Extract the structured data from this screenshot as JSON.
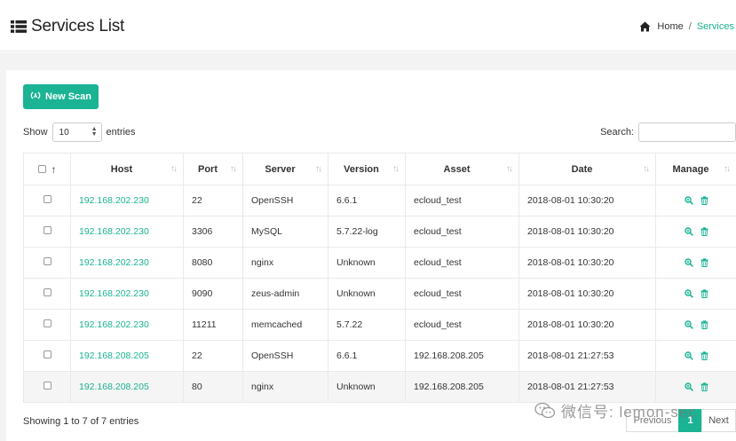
{
  "header": {
    "title": "Services List",
    "breadcrumb": {
      "home": "Home",
      "separator": "/",
      "current": "Services"
    }
  },
  "toolbar": {
    "new_scan_label": "New Scan"
  },
  "length": {
    "prefix": "Show",
    "value": "10",
    "suffix": "entries"
  },
  "search": {
    "label": "Search:",
    "value": ""
  },
  "table": {
    "columns": [
      "Host",
      "Port",
      "Server",
      "Version",
      "Asset",
      "Date",
      "Manage"
    ],
    "rows": [
      {
        "host": "192.168.202.230",
        "port": "22",
        "server": "OpenSSH",
        "version": "6.6.1",
        "asset": "ecloud_test",
        "date": "2018-08-01 10:30:20"
      },
      {
        "host": "192.168.202.230",
        "port": "3306",
        "server": "MySQL",
        "version": "5.7.22-log",
        "asset": "ecloud_test",
        "date": "2018-08-01 10:30:20"
      },
      {
        "host": "192.168.202.230",
        "port": "8080",
        "server": "nginx",
        "version": "Unknown",
        "asset": "ecloud_test",
        "date": "2018-08-01 10:30:20"
      },
      {
        "host": "192.168.202.230",
        "port": "9090",
        "server": "zeus-admin",
        "version": "Unknown",
        "asset": "ecloud_test",
        "date": "2018-08-01 10:30:20"
      },
      {
        "host": "192.168.202.230",
        "port": "11211",
        "server": "memcached",
        "version": "5.7.22",
        "asset": "ecloud_test",
        "date": "2018-08-01 10:30:20"
      },
      {
        "host": "192.168.208.205",
        "port": "22",
        "server": "OpenSSH",
        "version": "6.6.1",
        "asset": "192.168.208.205",
        "date": "2018-08-01 21:27:53"
      },
      {
        "host": "192.168.208.205",
        "port": "80",
        "server": "nginx",
        "version": "Unknown",
        "asset": "192.168.208.205",
        "date": "2018-08-01 21:27:53"
      }
    ]
  },
  "footer": {
    "info": "Showing 1 to 7 of 7 entries",
    "pagination": {
      "previous": "Previous",
      "current_page": "1",
      "next": "Next"
    }
  },
  "watermark": "微信号: lemon-sec",
  "colors": {
    "accent": "#1ab394",
    "background": "#f3f3f4"
  },
  "icons": {
    "title": "list-icon",
    "home": "home-icon",
    "new_scan": "radar-icon",
    "view": "zoom-in-icon",
    "delete": "trash-icon"
  }
}
